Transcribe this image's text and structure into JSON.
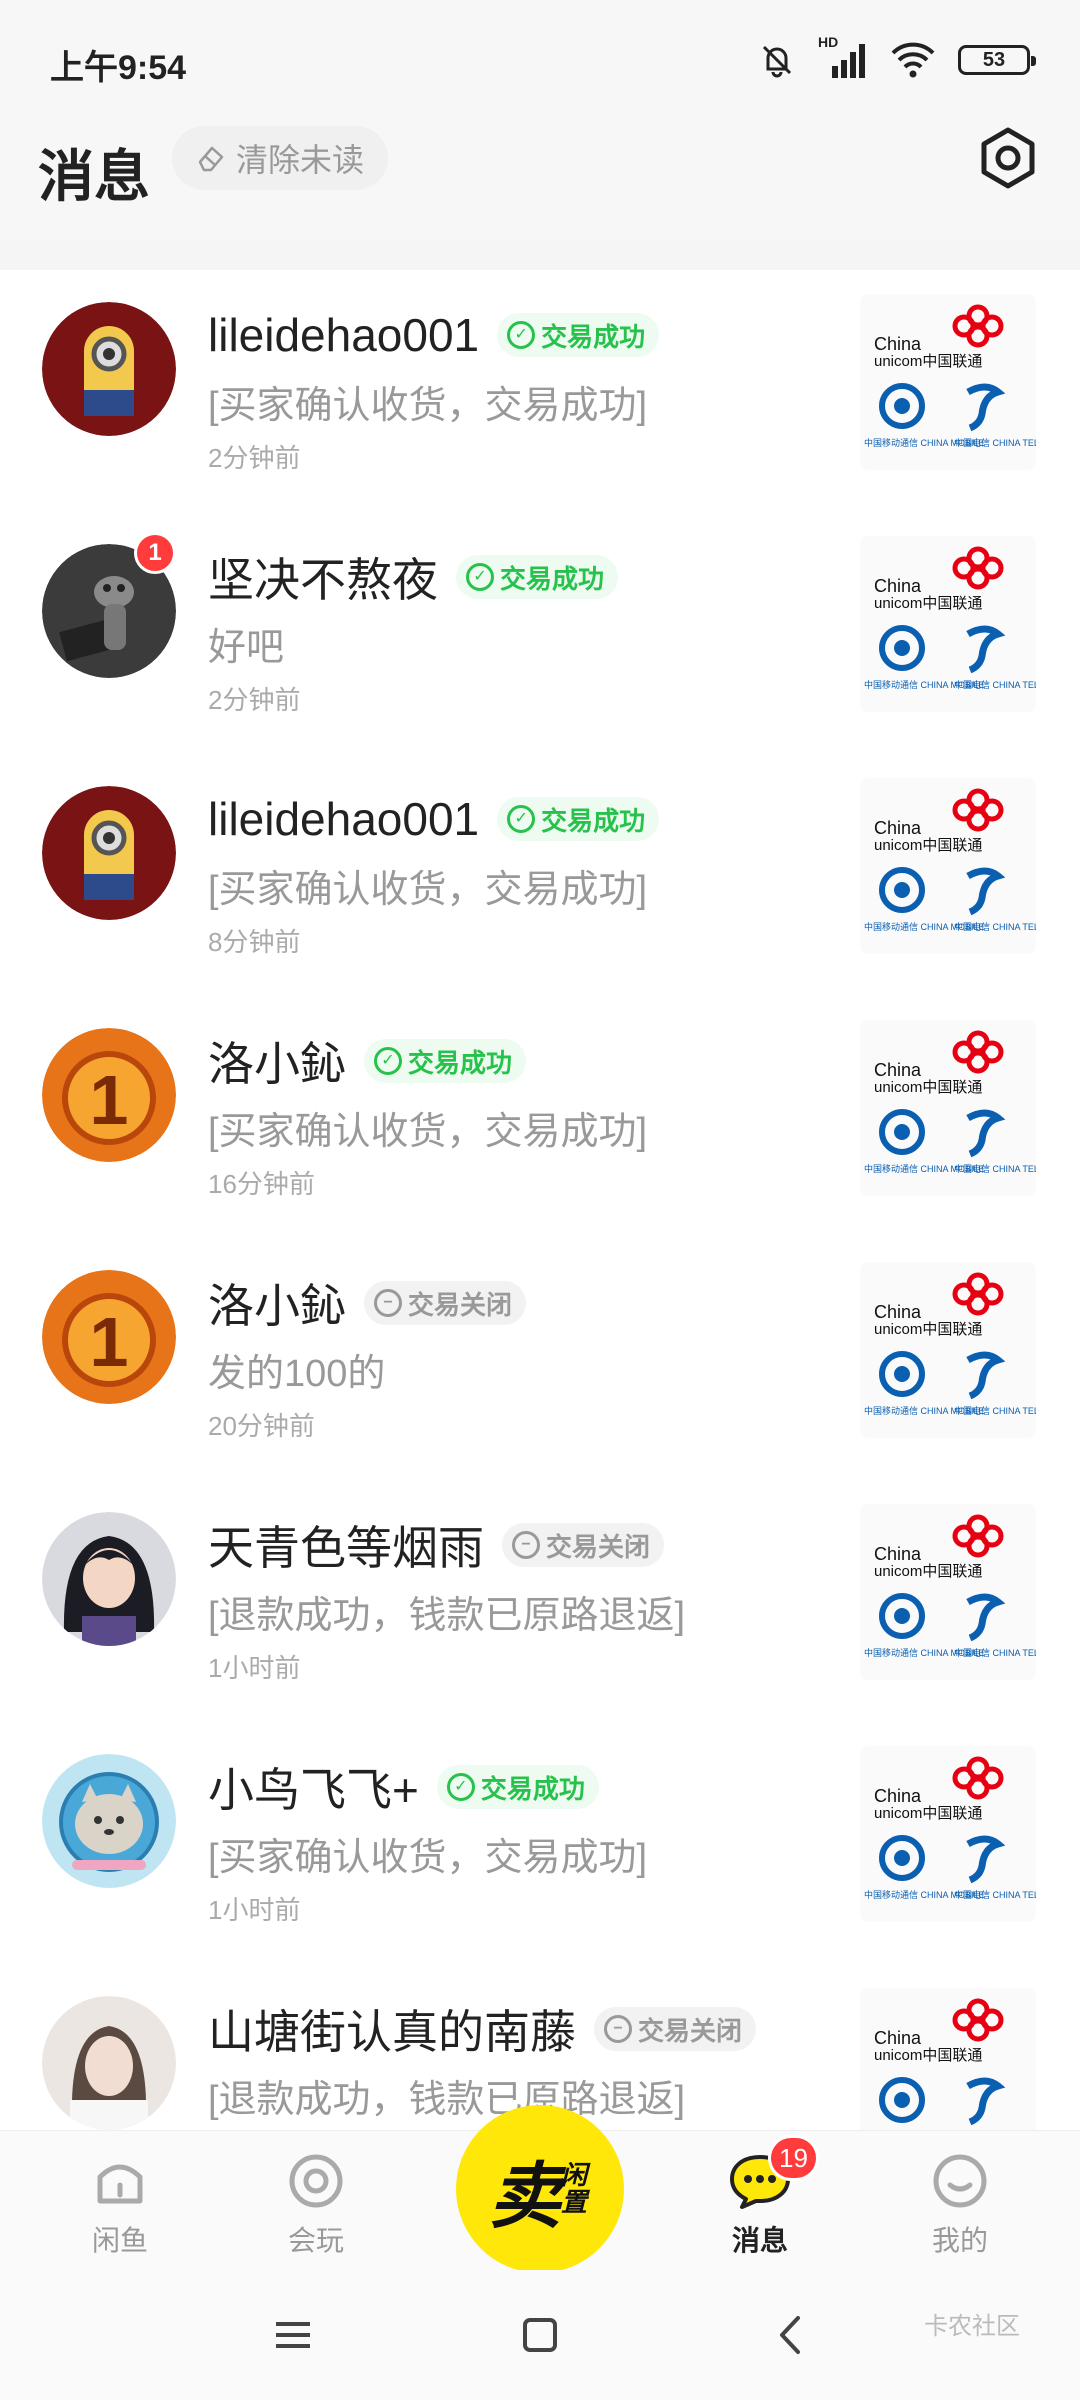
{
  "status_bar": {
    "time": "上午9:54",
    "network": "HD",
    "battery": "53"
  },
  "header": {
    "title": "消息",
    "clear_unread": "清除未读",
    "settings_icon": "settings-icon"
  },
  "messages": [
    {
      "name": "lileidehao001",
      "badge": "交易成功",
      "badge_type": "success",
      "preview": "[买家确认收货，交易成功]",
      "time": "2分钟前",
      "unread": "",
      "avatar_icon": "minion-avatar"
    },
    {
      "name": "坚决不熬夜",
      "badge": "交易成功",
      "badge_type": "success",
      "preview": "好吧",
      "time": "2分钟前",
      "unread": "1",
      "avatar_icon": "dark-figure-avatar"
    },
    {
      "name": "lileidehao001",
      "badge": "交易成功",
      "badge_type": "success",
      "preview": "[买家确认收货，交易成功]",
      "time": "8分钟前",
      "unread": "",
      "avatar_icon": "minion-avatar"
    },
    {
      "name": "洛小鈊",
      "badge": "交易成功",
      "badge_type": "success",
      "preview": "[买家确认收货，交易成功]",
      "time": "16分钟前",
      "unread": "",
      "avatar_icon": "number-one-medal-avatar"
    },
    {
      "name": "洛小鈊",
      "badge": "交易关闭",
      "badge_type": "closed",
      "preview": "发的100的",
      "time": "20分钟前",
      "unread": "",
      "avatar_icon": "number-one-medal-avatar"
    },
    {
      "name": "天青色等烟雨",
      "badge": "交易关闭",
      "badge_type": "closed",
      "preview": "[退款成功，钱款已原路退返]",
      "time": "1小时前",
      "unread": "",
      "avatar_icon": "anime-character-avatar"
    },
    {
      "name": "小鸟飞飞+",
      "badge": "交易成功",
      "badge_type": "success",
      "preview": "[买家确认收货，交易成功]",
      "time": "1小时前",
      "unread": "",
      "avatar_icon": "cat-astronaut-avatar"
    },
    {
      "name": "山塘街认真的南藤",
      "badge": "交易关闭",
      "badge_type": "closed",
      "preview": "[退款成功，钱款已原路退返]",
      "time": "",
      "unread": "",
      "avatar_icon": "girl-photo-avatar"
    }
  ],
  "thumbnail": {
    "unicom_line1": "China",
    "unicom_line2": "unicom中国联通",
    "mobile_label": "中国移动通信 CHINA MOBILE",
    "telecom_label": "中国电信 CHINA TELECOM"
  },
  "bottom_nav": {
    "items": [
      {
        "label": "闲鱼",
        "icon": "home-icon"
      },
      {
        "label": "会玩",
        "icon": "circle-target-icon"
      },
      {
        "label": "卖",
        "sub": "闲置",
        "icon": "sell-icon"
      },
      {
        "label": "消息",
        "icon": "chat-bubble-icon",
        "badge": "19"
      },
      {
        "label": "我的",
        "icon": "smile-face-icon"
      }
    ]
  },
  "system_nav": {
    "watermark": "卡农社区"
  },
  "colors": {
    "accent_yellow": "#ffe70a",
    "success_green": "#27c24c",
    "unread_red": "#ff3b3b"
  }
}
